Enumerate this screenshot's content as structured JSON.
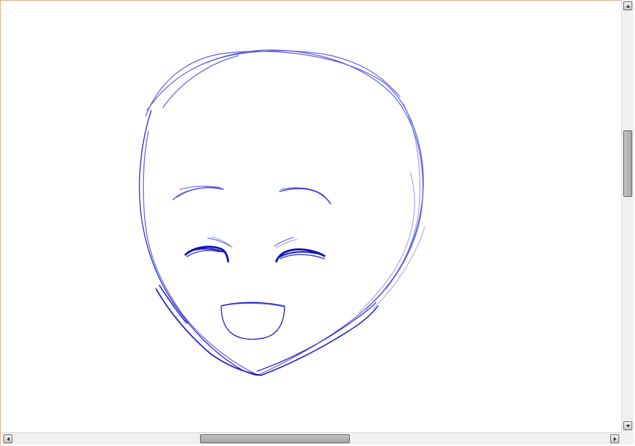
{
  "canvas": {
    "background": "#ffffff",
    "stroke_color": "#1a1ac8",
    "drawing": "sketch-face"
  },
  "scrollbars": {
    "vertical": {
      "position_fraction": 0.3,
      "up_icon": "arrow-up-icon",
      "down_icon": "arrow-down-icon"
    },
    "horizontal": {
      "position_fraction": 0.33,
      "left_icon": "arrow-left-icon",
      "right_icon": "arrow-right-icon"
    }
  },
  "frame_border_color": "#e8a878"
}
